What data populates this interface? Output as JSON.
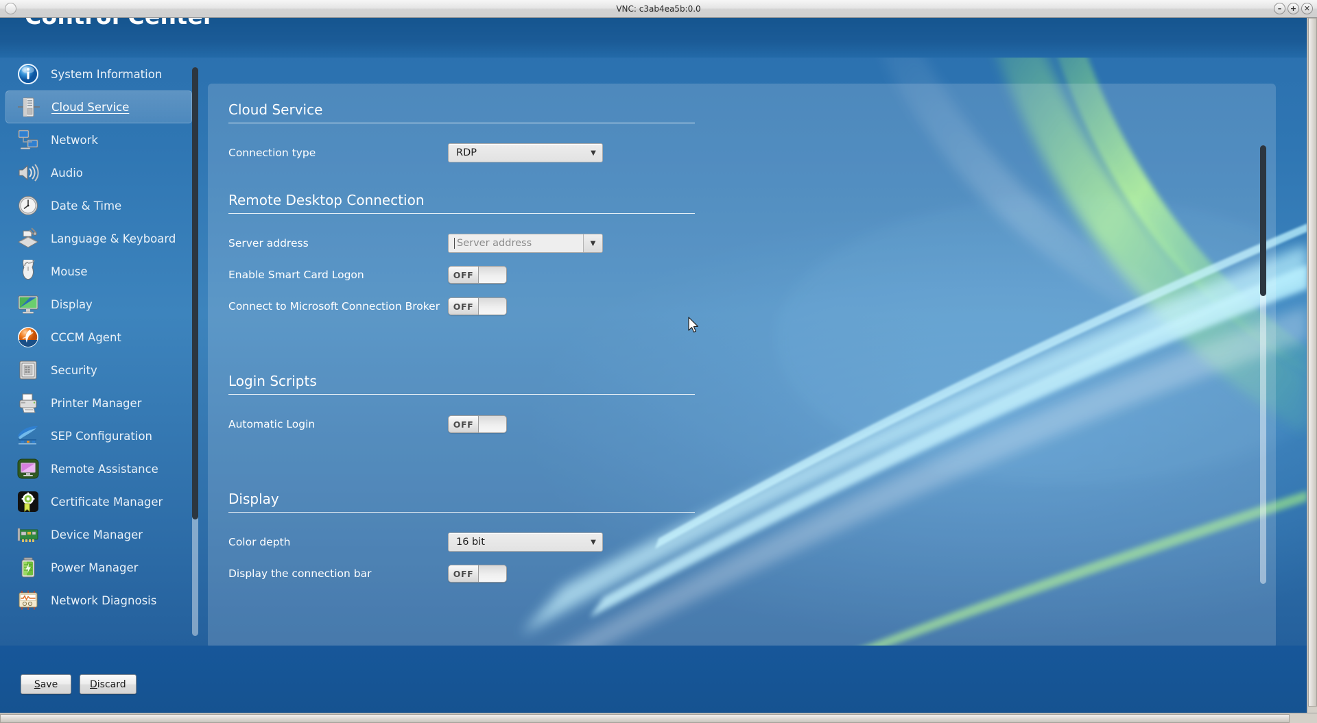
{
  "vnc": {
    "title": "VNC: c3ab4ea5b:0.0",
    "minimize_label": "–",
    "maximize_label": "+",
    "close_label": "✕"
  },
  "app": {
    "title": "Control Center"
  },
  "sidebar": {
    "items": [
      {
        "label": "System Information",
        "icon": "info-icon",
        "selected": false
      },
      {
        "label": "Cloud Service",
        "icon": "server-icon",
        "selected": true
      },
      {
        "label": "Network",
        "icon": "network-icon",
        "selected": false
      },
      {
        "label": "Audio",
        "icon": "speaker-icon",
        "selected": false
      },
      {
        "label": "Date & Time",
        "icon": "clock-icon",
        "selected": false
      },
      {
        "label": "Language & Keyboard",
        "icon": "keyboard-icon",
        "selected": false
      },
      {
        "label": "Mouse",
        "icon": "mouse-icon",
        "selected": false
      },
      {
        "label": "Display",
        "icon": "monitor-icon",
        "selected": false
      },
      {
        "label": "CCCM Agent",
        "icon": "cccm-agent-icon",
        "selected": false
      },
      {
        "label": "Security",
        "icon": "safe-icon",
        "selected": false
      },
      {
        "label": "Printer Manager",
        "icon": "printer-icon",
        "selected": false
      },
      {
        "label": "SEP Configuration",
        "icon": "sep-icon",
        "selected": false
      },
      {
        "label": "Remote Assistance",
        "icon": "remote-assistance-icon",
        "selected": false
      },
      {
        "label": "Certificate Manager",
        "icon": "certificate-icon",
        "selected": false
      },
      {
        "label": "Device Manager",
        "icon": "device-card-icon",
        "selected": false
      },
      {
        "label": "Power Manager",
        "icon": "battery-icon",
        "selected": false
      },
      {
        "label": "Network Diagnosis",
        "icon": "network-diagnosis-icon",
        "selected": false
      }
    ]
  },
  "content": {
    "sections": [
      {
        "heading": "Cloud Service",
        "rows": [
          {
            "label": "Connection type",
            "control": "combo",
            "value": "RDP"
          }
        ]
      },
      {
        "heading": "Remote Desktop Connection",
        "rows": [
          {
            "label": "Server address",
            "control": "combo-entry",
            "value": "",
            "placeholder": "Server address"
          },
          {
            "label": "Enable Smart Card Logon",
            "control": "toggle",
            "value": "OFF"
          },
          {
            "label": "Connect to Microsoft Connection Broker",
            "control": "toggle",
            "value": "OFF"
          }
        ]
      },
      {
        "heading": "Login Scripts",
        "rows": [
          {
            "label": "Automatic Login",
            "control": "toggle",
            "value": "OFF"
          }
        ]
      },
      {
        "heading": "Display",
        "rows": [
          {
            "label": "Color depth",
            "control": "combo",
            "value": "16 bit"
          },
          {
            "label": "Display the connection bar",
            "control": "toggle",
            "value": "OFF"
          }
        ]
      }
    ]
  },
  "footer": {
    "save_label": "Save",
    "save_mnemonic": "S",
    "discard_label": "Discard",
    "discard_mnemonic": "D"
  },
  "colors": {
    "window_blue": "#2f76b3",
    "header_blue": "#1b5b97",
    "panel_overlay": "rgba(255,255,255,0.16)",
    "selected_item": "rgba(255,255,255,0.22)",
    "scrollbar_thumb": "#2c3640",
    "text_primary": "#ffffff",
    "button_face": "#ececec"
  }
}
